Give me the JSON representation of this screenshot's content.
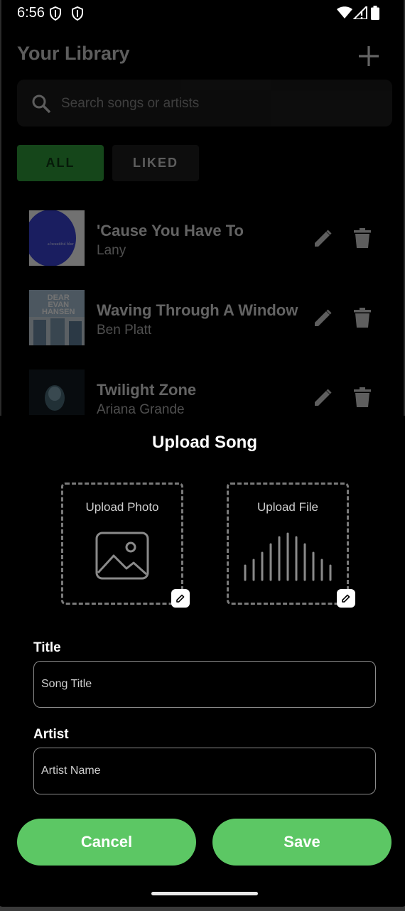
{
  "status_bar": {
    "time": "6:56",
    "left_icons": [
      "shield-icon",
      "shield-icon"
    ],
    "right_icons": [
      "wifi-icon",
      "signal-icon",
      "battery-icon"
    ]
  },
  "library": {
    "title": "Your Library",
    "add_icon": "plus-icon",
    "search": {
      "placeholder": "Search songs or artists",
      "icon": "search-icon"
    },
    "filters": [
      {
        "label": "ALL",
        "active": true
      },
      {
        "label": "LIKED",
        "active": false
      }
    ],
    "songs": [
      {
        "title": "'Cause You Have To",
        "artist": "Lany"
      },
      {
        "title": "Waving Through A Window",
        "artist": "Ben Platt"
      },
      {
        "title": "Twilight Zone",
        "artist": "Ariana Grande"
      }
    ],
    "album_text": {
      "lany": "a beautiful blur",
      "dear1": "DEAR",
      "dear2": "EVAN",
      "dear3": "HANSEN"
    }
  },
  "upload": {
    "title": "Upload Song",
    "photo_label": "Upload Photo",
    "file_label": "Upload File",
    "title_label": "Title",
    "title_placeholder": "Song Title",
    "artist_label": "Artist",
    "artist_placeholder": "Artist Name",
    "cancel_label": "Cancel",
    "save_label": "Save"
  },
  "colors": {
    "accent": "#5cc764",
    "chip_active": "#2f9c3a",
    "background": "#000000"
  }
}
